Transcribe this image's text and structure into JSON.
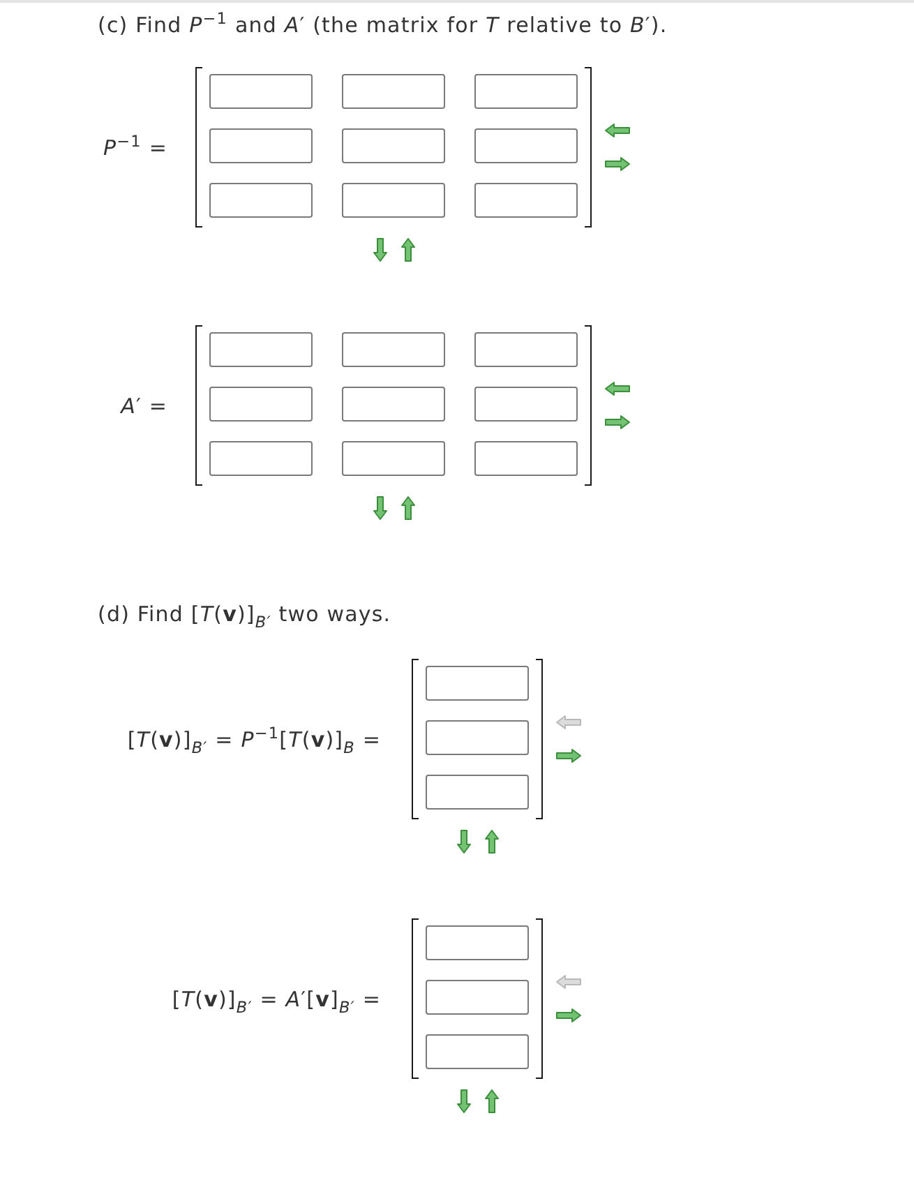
{
  "part_c": {
    "prompt": "(c) Find *P*$^{−1}$ and *A*′ (the matrix for *T* relative to *B*′).",
    "matrices": [
      {
        "label": "*P*$^{−1}$ =",
        "rows": [
          [
            {
              "kind": "answer_box"
            },
            {
              "kind": "answer_box"
            },
            {
              "kind": "answer_box"
            }
          ],
          [
            {
              "kind": "answer_box"
            },
            {
              "kind": "answer_box"
            },
            {
              "kind": "answer_box"
            }
          ],
          [
            {
              "kind": "answer_box"
            },
            {
              "kind": "answer_box"
            },
            {
              "kind": "answer_box"
            }
          ]
        ],
        "column_arrows": [
          {
            "kind": "left",
            "disabled": false
          },
          {
            "kind": "right",
            "disabled": false
          }
        ],
        "row_arrows": [
          {
            "kind": "down",
            "disabled": false
          },
          {
            "kind": "up",
            "disabled": false
          }
        ]
      },
      {
        "label": "*A*′ =",
        "rows": [
          [
            {
              "kind": "answer_box"
            },
            {
              "kind": "answer_box"
            },
            {
              "kind": "answer_box"
            }
          ],
          [
            {
              "kind": "answer_box"
            },
            {
              "kind": "answer_box"
            },
            {
              "kind": "answer_box"
            }
          ],
          [
            {
              "kind": "answer_box"
            },
            {
              "kind": "answer_box"
            },
            {
              "kind": "answer_box"
            }
          ]
        ],
        "column_arrows": [
          {
            "kind": "left",
            "disabled": false
          },
          {
            "kind": "right",
            "disabled": false
          }
        ],
        "row_arrows": [
          {
            "kind": "down",
            "disabled": false
          },
          {
            "kind": "up",
            "disabled": false
          }
        ]
      }
    ]
  },
  "part_d": {
    "prompt": "(d) Find [*T*(**v**)]$_{B′}$ two ways.",
    "equations": [
      {
        "label": "[*T*(**v**)]$_{B′}$ = *P*$^{−1}$[*T*(**v**)]$_{B}$ =",
        "rows": [
          [
            {
              "kind": "answer_box"
            }
          ],
          [
            {
              "kind": "answer_box"
            }
          ],
          [
            {
              "kind": "answer_box"
            }
          ]
        ],
        "column_arrows": [
          {
            "kind": "left",
            "disabled": true
          },
          {
            "kind": "right",
            "disabled": false
          }
        ],
        "row_arrows": [
          {
            "kind": "down",
            "disabled": false
          },
          {
            "kind": "up",
            "disabled": false
          }
        ]
      },
      {
        "label": "[*T*(**v**)]$_{B′}$ = *A*′[**v**]$_{B′}$ =",
        "rows": [
          [
            {
              "kind": "answer_box"
            }
          ],
          [
            {
              "kind": "answer_box"
            }
          ],
          [
            {
              "kind": "answer_box"
            }
          ]
        ],
        "column_arrows": [
          {
            "kind": "left",
            "disabled": true
          },
          {
            "kind": "right",
            "disabled": false
          }
        ],
        "row_arrows": [
          {
            "kind": "down",
            "disabled": false
          },
          {
            "kind": "up",
            "disabled": false
          }
        ]
      }
    ]
  }
}
